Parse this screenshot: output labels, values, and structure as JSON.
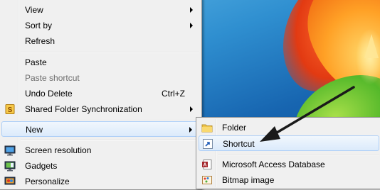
{
  "context_menu": {
    "view_label": "View",
    "sort_by_label": "Sort by",
    "refresh_label": "Refresh",
    "paste_label": "Paste",
    "paste_shortcut_label": "Paste shortcut",
    "undo_delete_label": "Undo Delete",
    "undo_delete_shortcut": "Ctrl+Z",
    "shared_folder_sync_label": "Shared Folder Synchronization",
    "new_label": "New",
    "screen_resolution_label": "Screen resolution",
    "gadgets_label": "Gadgets",
    "personalize_label": "Personalize"
  },
  "new_submenu": {
    "folder_label": "Folder",
    "shortcut_label": "Shortcut",
    "access_db_label": "Microsoft Access Database",
    "bitmap_label": "Bitmap image"
  },
  "icons": {
    "shared_folder_sync": "sync-icon",
    "screen_resolution": "monitor-icon",
    "gadgets": "gadgets-icon",
    "personalize": "personalize-icon",
    "folder": "folder-icon",
    "shortcut": "shortcut-icon",
    "access_db": "access-icon",
    "bitmap": "paint-icon"
  },
  "colors": {
    "menu_bg": "#f0f0f0",
    "highlight_border": "#aecff7",
    "arrow": "#1a1a1a"
  }
}
